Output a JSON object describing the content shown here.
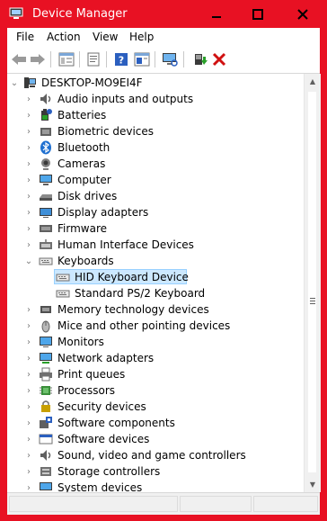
{
  "window": {
    "title": "Device Manager"
  },
  "menu": [
    "File",
    "Action",
    "View",
    "Help"
  ],
  "toolbar": {
    "tools": [
      "back-icon",
      "forward-icon",
      "show-hide-tree-icon",
      "properties-icon",
      "help-icon",
      "update-driver-icon",
      "scan-hardware-icon",
      "enable-device-icon",
      "uninstall-icon"
    ]
  },
  "tree": {
    "root": "DESKTOP-MO9EI4F",
    "categories": [
      {
        "label": "Audio inputs and outputs",
        "icon": "speaker-icon",
        "expanded": false
      },
      {
        "label": "Batteries",
        "icon": "battery-icon",
        "expanded": false
      },
      {
        "label": "Biometric devices",
        "icon": "fingerprint-icon",
        "expanded": false
      },
      {
        "label": "Bluetooth",
        "icon": "bluetooth-icon",
        "expanded": false
      },
      {
        "label": "Cameras",
        "icon": "camera-icon",
        "expanded": false
      },
      {
        "label": "Computer",
        "icon": "computer-icon",
        "expanded": false
      },
      {
        "label": "Disk drives",
        "icon": "disk-drive-icon",
        "expanded": false
      },
      {
        "label": "Display adapters",
        "icon": "display-adapter-icon",
        "expanded": false
      },
      {
        "label": "Firmware",
        "icon": "firmware-icon",
        "expanded": false
      },
      {
        "label": "Human Interface Devices",
        "icon": "hid-icon",
        "expanded": false
      },
      {
        "label": "Keyboards",
        "icon": "keyboard-icon",
        "expanded": true,
        "children": [
          {
            "label": "HID Keyboard Device",
            "selected": true
          },
          {
            "label": "Standard PS/2 Keyboard",
            "selected": false
          }
        ]
      },
      {
        "label": "Memory technology devices",
        "icon": "memory-icon",
        "expanded": false
      },
      {
        "label": "Mice and other pointing devices",
        "icon": "mouse-icon",
        "expanded": false
      },
      {
        "label": "Monitors",
        "icon": "monitor-icon",
        "expanded": false
      },
      {
        "label": "Network adapters",
        "icon": "network-icon",
        "expanded": false
      },
      {
        "label": "Print queues",
        "icon": "printer-icon",
        "expanded": false
      },
      {
        "label": "Processors",
        "icon": "processor-icon",
        "expanded": false
      },
      {
        "label": "Security devices",
        "icon": "security-icon",
        "expanded": false
      },
      {
        "label": "Software components",
        "icon": "software-component-icon",
        "expanded": false
      },
      {
        "label": "Software devices",
        "icon": "software-device-icon",
        "expanded": false
      },
      {
        "label": "Sound, video and game controllers",
        "icon": "sound-icon",
        "expanded": false
      },
      {
        "label": "Storage controllers",
        "icon": "storage-icon",
        "expanded": false
      },
      {
        "label": "System devices",
        "icon": "system-icon",
        "expanded": false
      }
    ]
  },
  "colors": {
    "titlebar": "#e81123",
    "selection_fill": "#cce8ff",
    "selection_border": "#99d1ff"
  }
}
